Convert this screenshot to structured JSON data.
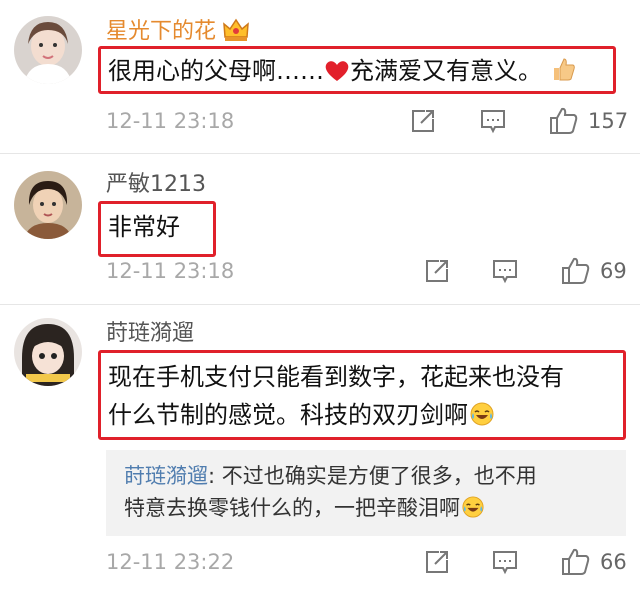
{
  "comments": [
    {
      "username": "星光下的花",
      "text_before_emoji": "很用心的父母啊……",
      "text_after_emoji": "充满爱又有意义。",
      "time": "12-11 23:18",
      "likes": "157"
    },
    {
      "username": "严敏1213",
      "text": "非常好",
      "time": "12-11 23:18",
      "likes": "69"
    },
    {
      "username": "莳琏漪遛",
      "text_line1": "现在手机支付只能看到数字，花起来也没有",
      "text_line2": "什么节制的感觉。科技的双刃剑啊",
      "reply": {
        "author": "莳琏漪遛",
        "separator": ":",
        "line1": " 不过也确实是方便了很多，也不用",
        "line2": "特意去换零钱什么的，一把辛酸泪啊"
      },
      "time": "12-11 23:22",
      "likes": "66"
    }
  ],
  "colors": {
    "vip_username": "#e58a2e",
    "username": "#555555",
    "highlight_box": "#e0202a",
    "reply_author": "#507daf",
    "reply_bg": "#f2f2f2",
    "timestamp": "#a8a8a8"
  },
  "icons": [
    "crown-icon",
    "heart-icon",
    "thumbs-up-emoji",
    "laugh-cry-emoji",
    "share-icon",
    "comment-icon",
    "like-icon"
  ]
}
